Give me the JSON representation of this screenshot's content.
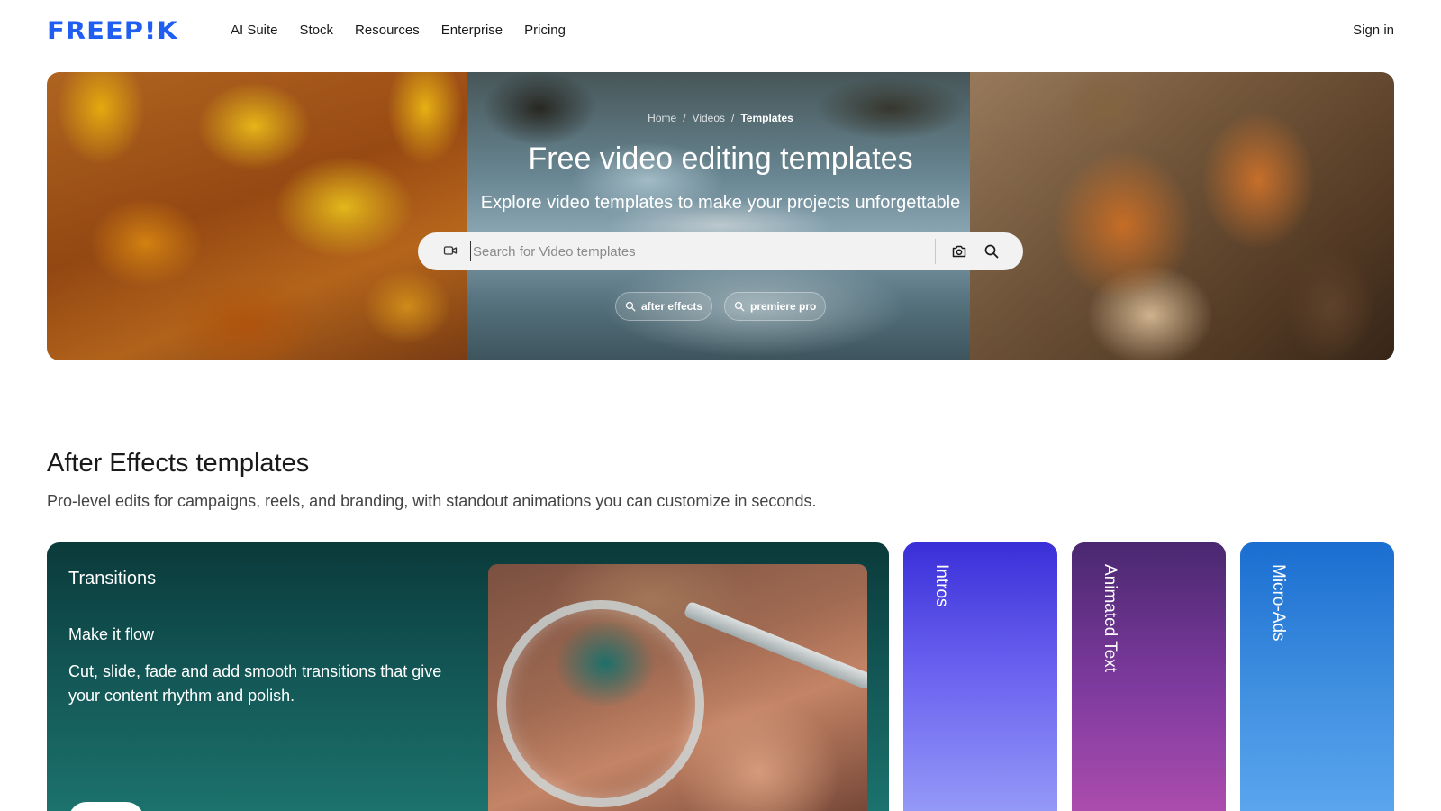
{
  "header": {
    "logo_text": "FREEP!K",
    "nav": [
      "AI Suite",
      "Stock",
      "Resources",
      "Enterprise",
      "Pricing"
    ],
    "sign_in": "Sign in",
    "brand_color": "#1f5ef0"
  },
  "hero": {
    "breadcrumb": [
      "Home",
      "Videos",
      "Templates"
    ],
    "breadcrumb_sep": "/",
    "title": "Free video editing templates",
    "subtitle": "Explore video templates to make your projects unforgettable",
    "search": {
      "placeholder": "Search for Video templates",
      "value": "",
      "left_icon": "video-camera-icon",
      "image_search_icon": "camera-icon",
      "submit_icon": "search-icon"
    },
    "suggestions": [
      "after effects",
      "premiere pro"
    ]
  },
  "section": {
    "title": "After Effects templates",
    "description": "Pro-level edits for campaigns, reels, and branding, with standout animations you can customize in seconds."
  },
  "cards": {
    "main": {
      "title": "Transitions",
      "subtitle": "Make it flow",
      "body": "Cut, slide, fade and add smooth transitions that give your content rhythm and polish."
    },
    "side": [
      "Intros",
      "Animated Text",
      "Micro-Ads"
    ]
  }
}
